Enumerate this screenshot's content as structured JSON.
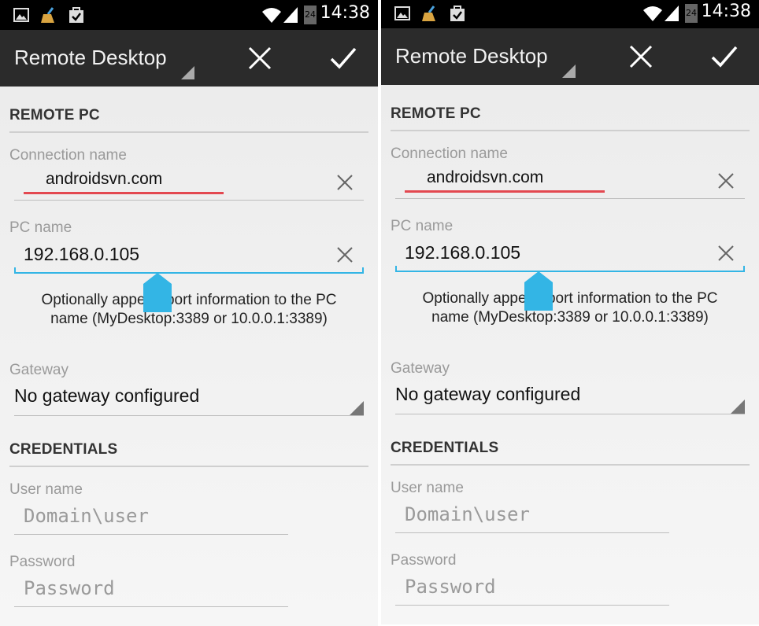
{
  "status": {
    "time": "14:38",
    "sim_badge": "24"
  },
  "actionbar": {
    "title": "Remote Desktop"
  },
  "form": {
    "section_remote": "REMOTE PC",
    "connection_label": "Connection name",
    "connection_value": "androidsvn.com",
    "pc_label": "PC name",
    "pc_value": "192.168.0.105",
    "hint": "Optionally append port information to the PC name (MyDesktop:3389 or 10.0.0.1:3389)",
    "gateway_label": "Gateway",
    "gateway_value": "No gateway configured",
    "section_credentials": "CREDENTIALS",
    "user_label": "User name",
    "user_placeholder": "Domain\\user",
    "password_label": "Password",
    "password_placeholder": "Password"
  },
  "colors": {
    "accent": "#33b5e5",
    "error_underline": "#e34850",
    "actionbar": "#2b2b2b",
    "statusbar": "#000000"
  },
  "icons": [
    "gallery-icon",
    "cleaner-broom-icon",
    "bag-check-icon",
    "wifi-icon",
    "signal-icon",
    "sim-icon",
    "close-icon",
    "check-icon",
    "clear-text-icon",
    "selection-handle-icon",
    "dropdown-triangle-icon"
  ]
}
